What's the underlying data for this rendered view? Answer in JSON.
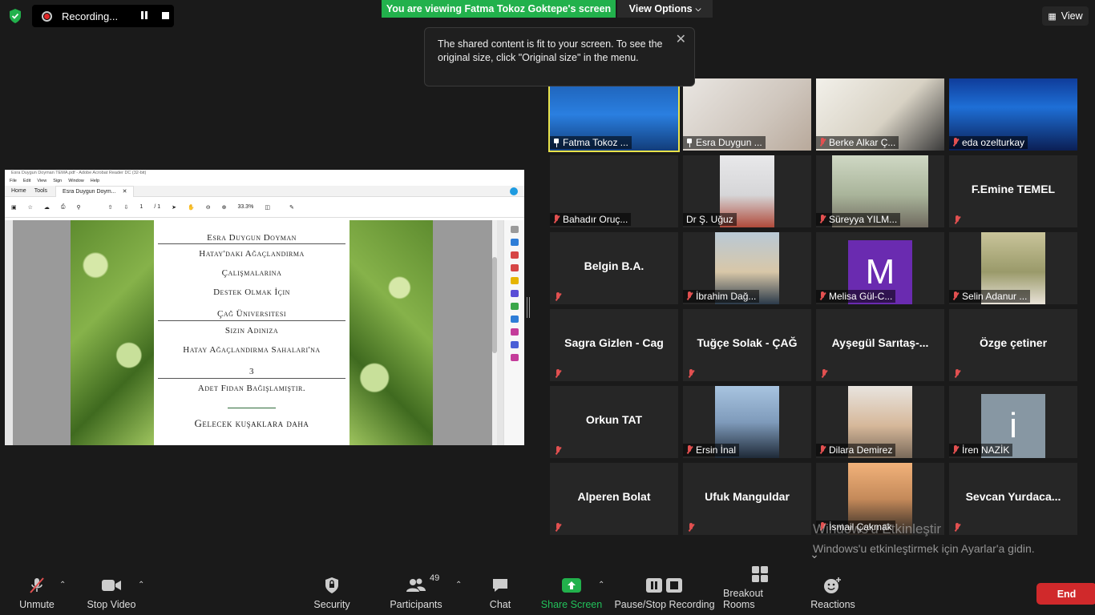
{
  "topbar": {
    "recording_label": "Recording...",
    "viewing_label": "You are viewing Fatma Tokoz Goktepe's screen",
    "view_options_label": "View Options",
    "view_label": "View",
    "tooltip_text": "The shared content is fit to your screen. To see the original size, click \"Original size\" in the menu."
  },
  "share": {
    "window_title": "Esra Duygun Doyman TEMA.pdf - Adobe Acrobat Reader DC (32-bit)",
    "menu": [
      "File",
      "Edit",
      "View",
      "Sign",
      "Window",
      "Help"
    ],
    "tab_home": "Home",
    "tab_tools": "Tools",
    "tab_doc": "Esra Duygun Doym...",
    "page_num": "1",
    "page_total": "/ 1",
    "zoom": "33.3%",
    "cert_lines": [
      "Esra Duygun Doyman",
      "Hatay'daki Ağaçlandırma",
      "Çalışmalarına",
      "Destek Olmak İçin",
      "Çağ Üniversitesi",
      "Sizin Adınıza",
      "Hatay Ağaçlandırma Sahaları'na",
      "3",
      "Adet Fidan Bağışlamıştır.",
      "Gelecek kuşaklara daha"
    ]
  },
  "participants": [
    {
      "name": "Fatma Tokoz ...",
      "video": true,
      "pinned": true,
      "active": true
    },
    {
      "name": "Esra Duygun ...",
      "video": true,
      "pinned": true
    },
    {
      "name": "Berke Alkar Ç...",
      "video": true
    },
    {
      "name": "eda ozelturkay",
      "video": true
    },
    {
      "name": "Bahadır Oruç...",
      "video": true
    },
    {
      "name": "Dr Ş. Uğuz",
      "video": true,
      "unmuted": true
    },
    {
      "name": "Süreyya YILM...",
      "video": true
    },
    {
      "name": "F.Emine TEMEL",
      "video": false
    },
    {
      "name": "Belgin B.A.",
      "video": false
    },
    {
      "name": "İbrahim Dağ...",
      "video": true
    },
    {
      "name": "Melisa Gül-C...",
      "avatar_letter": "M"
    },
    {
      "name": "Selin Adanur ...",
      "video": true
    },
    {
      "name": "Sagra Gizlen - Cag",
      "video": false
    },
    {
      "name": "Tuğçe Solak - ÇAĞ",
      "video": false
    },
    {
      "name": "Ayşegül  Sarıtaş-...",
      "video": false
    },
    {
      "name": "Özge çetiner",
      "video": false
    },
    {
      "name": "Orkun TAT",
      "video": false
    },
    {
      "name": "Ersin İnal",
      "video": true
    },
    {
      "name": "Dilara Demirez",
      "video": true
    },
    {
      "name": "İren NAZİK",
      "avatar_letter": "i"
    },
    {
      "name": "Alperen Bolat",
      "video": false
    },
    {
      "name": "Ufuk Manguldar",
      "video": false
    },
    {
      "name": "İsmail Çakmak",
      "video": true
    },
    {
      "name": "Sevcan  Yurdaca...",
      "video": false
    }
  ],
  "watermark": {
    "title": "Windows'u Etkinleştir",
    "subtitle": "Windows'u etkinleştirmek için Ayarlar'a gidin."
  },
  "toolbar": {
    "unmute": "Unmute",
    "stop_video": "Stop Video",
    "security": "Security",
    "participants": "Participants",
    "participants_count": "49",
    "chat": "Chat",
    "share_screen": "Share Screen",
    "pause_stop_recording": "Pause/Stop Recording",
    "breakout_rooms": "Breakout Rooms",
    "reactions": "Reactions",
    "end": "End"
  },
  "colors": {
    "share_green": "#22b14c",
    "end_red": "#d0292b",
    "muted_red": "#e25050",
    "active_speaker": "#e9e34a"
  }
}
